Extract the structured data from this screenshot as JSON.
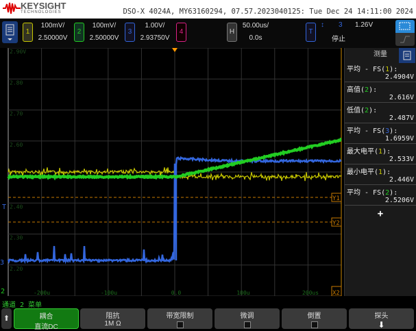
{
  "header": {
    "brand": "KEYSIGHT",
    "brand_sub": "TECHNOLOGIES",
    "instrument": "DSO-X 4024A, MY63160294, 07.57.2023040125: Tue Dec 24 14:11:00 2024"
  },
  "channels": [
    {
      "num": "1",
      "scale": "100mV/",
      "offset": "2.50000V",
      "color": "#c8c800"
    },
    {
      "num": "2",
      "scale": "100mV/",
      "offset": "2.50000V",
      "color": "#22cc22"
    },
    {
      "num": "3",
      "scale": "1.00V/",
      "offset": "2.93750V",
      "color": "#3366dd"
    },
    {
      "num": "4",
      "scale": "",
      "offset": "",
      "color": "#dd2288"
    }
  ],
  "horizontal": {
    "label": "H",
    "scale": "50.00us/",
    "delay": "0.0s"
  },
  "trigger": {
    "label": "T",
    "source": "3",
    "level": "1.26V",
    "status": "停止"
  },
  "y_labels": [
    "2.90V",
    "2.80",
    "2.70",
    "2.60",
    "2.50",
    "2.40",
    "2.30",
    "2.20"
  ],
  "x_labels": [
    "-200u",
    "-100u",
    "0.0",
    "100u",
    "200us"
  ],
  "markers": {
    "y1": "Y1",
    "y2": "Y2",
    "x2": "X2",
    "trig": "T",
    "ch2": "2",
    "ch3": "3"
  },
  "measurements": {
    "title": "测量",
    "items": [
      {
        "name": "平均 - FS",
        "ch": "1",
        "value": "2.4904V",
        "color": "#c8c800"
      },
      {
        "name": "高值",
        "ch": "2",
        "value": "2.616V",
        "color": "#22cc22"
      },
      {
        "name": "低值",
        "ch": "2",
        "value": "2.487V",
        "color": "#22cc22"
      },
      {
        "name": "平均 - FS",
        "ch": "3",
        "value": "1.6959V",
        "color": "#3366dd"
      },
      {
        "name": "最大电平",
        "ch": "1",
        "value": "2.533V",
        "color": "#c8c800"
      },
      {
        "name": "最小电平",
        "ch": "1",
        "value": "2.446V",
        "color": "#c8c800"
      },
      {
        "name": "平均 - FS",
        "ch": "2",
        "value": "2.5206V",
        "color": "#22cc22"
      }
    ],
    "add": "+"
  },
  "menu": {
    "title": "通道 2 菜单",
    "softkeys": [
      {
        "label": "耦合",
        "value": "直流DC"
      },
      {
        "label": "阻抗",
        "value": "1M Ω"
      },
      {
        "label": "带宽限制",
        "value": ""
      },
      {
        "label": "微调",
        "value": ""
      },
      {
        "label": "倒置",
        "value": ""
      },
      {
        "label": "探头",
        "value": ""
      }
    ]
  }
}
